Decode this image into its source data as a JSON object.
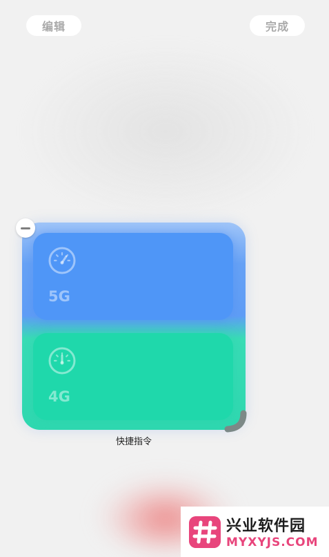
{
  "header": {
    "edit_label": "编辑",
    "done_label": "完成"
  },
  "widget": {
    "caption": "快捷指令",
    "tiles": [
      {
        "label": "5G",
        "icon": "speedometer-icon",
        "color": "#4f96f7"
      },
      {
        "label": "4G",
        "icon": "speedometer-icon",
        "color": "#1fd8ab"
      }
    ]
  },
  "watermark": {
    "title": "兴业软件园",
    "subtitle": "MYXYJS.COM",
    "accent": "#e8457c"
  }
}
